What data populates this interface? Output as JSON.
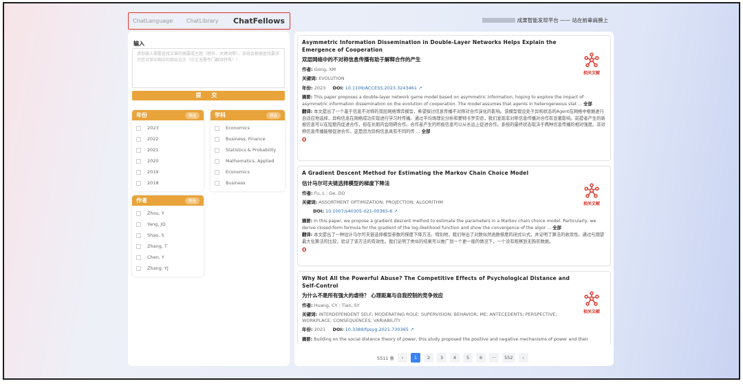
{
  "nav": {
    "tabs": [
      "ChatLanguage",
      "ChatLibrary",
      "ChatFellows"
    ],
    "active": "ChatFellows",
    "brand": "成果智能发现平台 —— 站在前辈肩膀上"
  },
  "input": {
    "label": "输入",
    "placeholder": "请你输入需要查找文章的摘要或主题（题名、关键词等），系统会根据查找要求对您对单中相应的相似论文（中文无需专门翻译特殊！）",
    "submit": "提 交"
  },
  "filters": {
    "year": {
      "title": "年份",
      "pill": "筛选",
      "items": [
        "2023",
        "2022",
        "2021",
        "2020",
        "2019",
        "2018"
      ]
    },
    "subject": {
      "title": "学科",
      "pill": "筛选",
      "items": [
        "Economics",
        "Business, Finance",
        "Statistics & Probability",
        "Mathematics, Applied",
        "Economics",
        "Business"
      ]
    },
    "author": {
      "title": "作者",
      "pill": "筛选",
      "items": [
        "Zhou, Y",
        "Yang, JQ",
        "Shao, S",
        "Zhang, T",
        "Chen, Y",
        "Zhang, YJ"
      ]
    }
  },
  "labels": {
    "author": "作者:",
    "keywords": "关键词:",
    "year": "年份:",
    "doi": "DOI:",
    "abstract": "摘要:",
    "translation": "翻译:",
    "more": "全部",
    "related": "相关文献",
    "link_icon": "↗"
  },
  "results": [
    {
      "title": "Asymmetric Information Dissemination in Double-Layer Networks Helps Explain the Emergence of Cooperation",
      "title_cn": "双层网络中的不对称信息传播有助于解释合作的产生",
      "authors": "Gong, XM",
      "keywords": "EVOLUTION",
      "year": "2023",
      "doi": "10.1109/ACCESS.2023.3243461",
      "abstract": "This paper proposes a double-layer network game model based on asymmetric information, hoping to explore the impact of asymmetric information dissemination on the evolution of cooperation. The model assumes that agents in heterogeneous stat ...",
      "translation": "本文提出了一个基于信息不对称的双层网络博弈模型，希望探讨信息传播不对称对合作演化的影响。该模型假设处于异构状态的Agent在网络中根据进行自适应地选择，异构信息在网络成功实现进行学习时传播。通过平均场理论分析和蒙特卡罗实验，我们发现非对称信息传播对合作有显著影响。前提者产生的新报信息可以在短期内促进合作，但在长期内会阻碍合作。合作者产生的积极信息可以从长远上促进合作。系统的最终状态取决于两种信息传播的相对强度。非对称信息传播能够促进合作，这是因为异构信息具有不同的传 ...",
      "count": "0"
    },
    {
      "title": "A Gradient Descent Method for Estimating the Markov Chain Choice Model",
      "title_cn": "估计马尔可夫链选择模型的梯度下降法",
      "authors": "Fu, L ; Ge, DD",
      "keywords": "ASSORTMENT OPTIMIZATION; PROJECTION; ALGORITHM",
      "year": "",
      "doi": "10.1007/s40305-021-00365-6",
      "abstract": "In this paper, we propose a gradient descent method to estimate the parameters in a Markov chain choice model. Particularly, we derive closed-form formula for the gradient of the log-likelihood function and show the convergence of the algor ...",
      "translation": "本文提出了一种估计马尔可夫链选择模型参数的梯度下降方法。特别地，我们导出了对数似然函数梯度的闭式公式，并证明了算法的收敛性。通过与期望最大化算法的比较，验证了该方法的有效性。我们证明了类似的结果可以推广到一个更一般的情况下，一个没有观察到无购买数据。",
      "count": "0"
    },
    {
      "title": "Why Not All the Powerful Abuse? The Competitive Effects of Psychological Distance and Self-Control",
      "title_cn": "为什么不是所有强大的虐待？ 心理距离与自我控制的竞争效应",
      "authors": "Huang, CY ; Tian, SY",
      "keywords": "INTERDEPENDENT SELF; MODERATING ROLE; SUPERVISION; BEHAVIOR; ME; ANTECEDENTS; PERSPECTIVE; WORKPLACE; CONSEQUENCES; VARIABILITY",
      "year": "2021",
      "doi": "10.3389/fpsyg.2021.730365",
      "abstract": "Building on the social distance theory of power, this study proposed the positive and negative mechanisms of power and their",
      "translation": "",
      "count": ""
    }
  ],
  "pagination": {
    "total": "5511 条",
    "prev": "‹",
    "pages": [
      "1",
      "2",
      "3",
      "4",
      "5",
      "6",
      "···",
      "552"
    ],
    "next": "›",
    "active": "1"
  },
  "colors": {
    "accent": "#e8a33a",
    "highlight_border": "#d9342b",
    "link": "#2b6cb0",
    "page_active": "#3b82f6"
  },
  "icons": [
    "related-docs-icon",
    "checkbox-icon",
    "external-link-icon"
  ]
}
